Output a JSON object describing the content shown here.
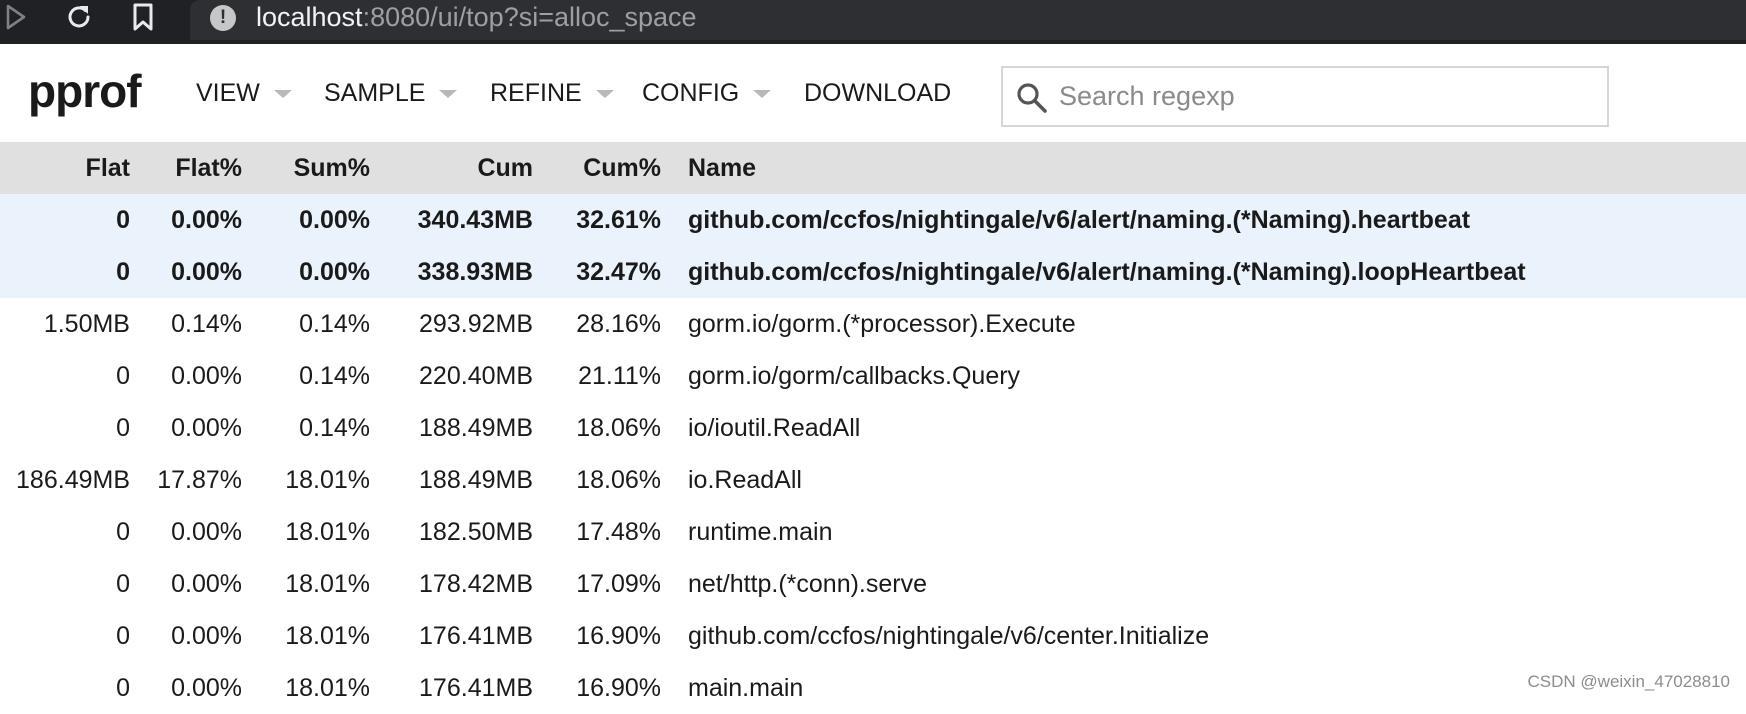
{
  "browser": {
    "url_host": "localhost",
    "url_rest": ":8080/ui/top?si=alloc_space"
  },
  "app": {
    "logo": "pprof",
    "menu": [
      {
        "label": "VIEW",
        "has_caret": true
      },
      {
        "label": "SAMPLE",
        "has_caret": true
      },
      {
        "label": "REFINE",
        "has_caret": true
      },
      {
        "label": "CONFIG",
        "has_caret": true
      },
      {
        "label": "DOWNLOAD",
        "has_caret": false
      }
    ],
    "search": {
      "placeholder": "Search regexp",
      "value": ""
    }
  },
  "table": {
    "columns": {
      "flat": "Flat",
      "flat_pct": "Flat%",
      "sum_pct": "Sum%",
      "cum": "Cum",
      "cum_pct": "Cum%",
      "name": "Name"
    },
    "rows": [
      {
        "flat": "0",
        "flat_pct": "0.00%",
        "sum_pct": "0.00%",
        "cum": "340.43MB",
        "cum_pct": "32.61%",
        "name": "github.com/ccfos/nightingale/v6/alert/naming.(*Naming).heartbeat",
        "highlighted": true
      },
      {
        "flat": "0",
        "flat_pct": "0.00%",
        "sum_pct": "0.00%",
        "cum": "338.93MB",
        "cum_pct": "32.47%",
        "name": "github.com/ccfos/nightingale/v6/alert/naming.(*Naming).loopHeartbeat",
        "highlighted": true
      },
      {
        "flat": "1.50MB",
        "flat_pct": "0.14%",
        "sum_pct": "0.14%",
        "cum": "293.92MB",
        "cum_pct": "28.16%",
        "name": "gorm.io/gorm.(*processor).Execute",
        "highlighted": false
      },
      {
        "flat": "0",
        "flat_pct": "0.00%",
        "sum_pct": "0.14%",
        "cum": "220.40MB",
        "cum_pct": "21.11%",
        "name": "gorm.io/gorm/callbacks.Query",
        "highlighted": false
      },
      {
        "flat": "0",
        "flat_pct": "0.00%",
        "sum_pct": "0.14%",
        "cum": "188.49MB",
        "cum_pct": "18.06%",
        "name": "io/ioutil.ReadAll",
        "highlighted": false
      },
      {
        "flat": "186.49MB",
        "flat_pct": "17.87%",
        "sum_pct": "18.01%",
        "cum": "188.49MB",
        "cum_pct": "18.06%",
        "name": "io.ReadAll",
        "highlighted": false
      },
      {
        "flat": "0",
        "flat_pct": "0.00%",
        "sum_pct": "18.01%",
        "cum": "182.50MB",
        "cum_pct": "17.48%",
        "name": "runtime.main",
        "highlighted": false
      },
      {
        "flat": "0",
        "flat_pct": "0.00%",
        "sum_pct": "18.01%",
        "cum": "178.42MB",
        "cum_pct": "17.09%",
        "name": "net/http.(*conn).serve",
        "highlighted": false
      },
      {
        "flat": "0",
        "flat_pct": "0.00%",
        "sum_pct": "18.01%",
        "cum": "176.41MB",
        "cum_pct": "16.90%",
        "name": "github.com/ccfos/nightingale/v6/center.Initialize",
        "highlighted": false
      },
      {
        "flat": "0",
        "flat_pct": "0.00%",
        "sum_pct": "18.01%",
        "cum": "176.41MB",
        "cum_pct": "16.90%",
        "name": "main.main",
        "highlighted": false
      }
    ]
  },
  "watermark": "CSDN @weixin_47028810",
  "colors": {
    "chrome_bg": "#202124",
    "url_bg": "#2e2f33",
    "header_row_bg": "#e0e0e0",
    "highlight_row_bg": "#eaf2fb"
  },
  "icons": {
    "forward": "play-triangle-icon",
    "reload": "reload-icon",
    "bookmark": "bookmark-icon",
    "site_info": "info-circle-icon",
    "search": "search-icon"
  }
}
